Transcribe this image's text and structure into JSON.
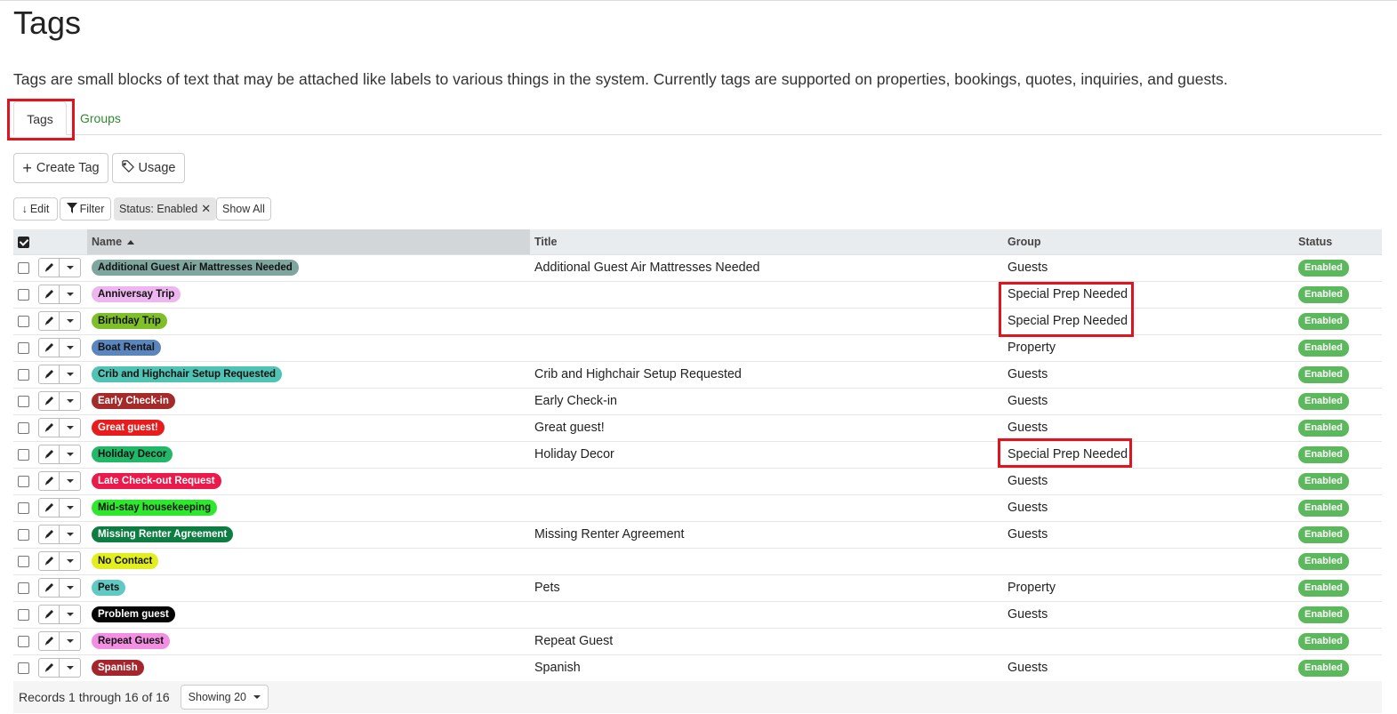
{
  "page": {
    "title": "Tags",
    "description": "Tags are small blocks of text that may be attached like labels to various things in the system. Currently tags are supported on properties, bookings, quotes, inquiries, and guests."
  },
  "tabs": [
    {
      "label": "Tags",
      "active": true
    },
    {
      "label": "Groups",
      "active": false
    }
  ],
  "toolbar": {
    "create_label": "Create Tag",
    "usage_label": "Usage",
    "edit_label": "Edit",
    "filter_label": "Filter",
    "filter_chip": "Status: Enabled",
    "chip_remove": "✕",
    "show_all_label": "Show All"
  },
  "table": {
    "headers": {
      "name": "Name",
      "title": "Title",
      "group": "Group",
      "status": "Status"
    },
    "sort": {
      "column": "name",
      "direction": "asc"
    },
    "rows": [
      {
        "name": "Additional Guest Air Mattresses Needed",
        "color": "#7fa69e",
        "text_color": "#111",
        "title": "Additional Guest Air Mattresses Needed",
        "group": "Guests",
        "status": "Enabled"
      },
      {
        "name": "Anniversay Trip",
        "color": "#eeb6ef",
        "text_color": "#111",
        "title": "",
        "group": "Special Prep Needed",
        "status": "Enabled"
      },
      {
        "name": "Birthday Trip",
        "color": "#7fbf2a",
        "text_color": "#111",
        "title": "",
        "group": "Special Prep Needed",
        "status": "Enabled"
      },
      {
        "name": "Boat Rental",
        "color": "#5b86bd",
        "text_color": "#111",
        "title": "",
        "group": "Property",
        "status": "Enabled"
      },
      {
        "name": "Crib and Highchair Setup Requested",
        "color": "#4fc3b4",
        "text_color": "#111",
        "title": "Crib and Highchair Setup Requested",
        "group": "Guests",
        "status": "Enabled"
      },
      {
        "name": "Early Check-in",
        "color": "#a52a2a",
        "text_color": "#fff",
        "title": "Early Check-in",
        "group": "Guests",
        "status": "Enabled"
      },
      {
        "name": "Great guest!",
        "color": "#e81c1c",
        "text_color": "#fff",
        "title": "Great guest!",
        "group": "Guests",
        "status": "Enabled"
      },
      {
        "name": "Holiday Decor",
        "color": "#21b86a",
        "text_color": "#111",
        "title": "Holiday Decor",
        "group": "Special Prep Needed",
        "status": "Enabled"
      },
      {
        "name": "Late Check-out Request",
        "color": "#ec1a4a",
        "text_color": "#fff",
        "title": "",
        "group": "Guests",
        "status": "Enabled"
      },
      {
        "name": "Mid-stay housekeeping",
        "color": "#2ee82e",
        "text_color": "#111",
        "title": "",
        "group": "Guests",
        "status": "Enabled"
      },
      {
        "name": "Missing Renter Agreement",
        "color": "#0e7d42",
        "text_color": "#fff",
        "title": "Missing Renter Agreement",
        "group": "Guests",
        "status": "Enabled"
      },
      {
        "name": "No Contact",
        "color": "#e3ee1e",
        "text_color": "#111",
        "title": "",
        "group": "",
        "status": "Enabled"
      },
      {
        "name": "Pets",
        "color": "#5fc9c2",
        "text_color": "#111",
        "title": "Pets",
        "group": "Property",
        "status": "Enabled"
      },
      {
        "name": "Problem guest",
        "color": "#050505",
        "text_color": "#fff",
        "title": "",
        "group": "Guests",
        "status": "Enabled"
      },
      {
        "name": "Repeat Guest",
        "color": "#f28fe3",
        "text_color": "#111",
        "title": "Repeat Guest",
        "group": "",
        "status": "Enabled"
      },
      {
        "name": "Spanish",
        "color": "#a4262c",
        "text_color": "#fff",
        "title": "Spanish",
        "group": "Guests",
        "status": "Enabled"
      }
    ]
  },
  "footer": {
    "records_text": "Records 1 through 16 of 16",
    "page_size_label": "Showing 20"
  },
  "colors": {
    "accent_link": "#2e8b2e",
    "status_enabled": "#5cb85c",
    "highlight_box": "#e0141e"
  }
}
